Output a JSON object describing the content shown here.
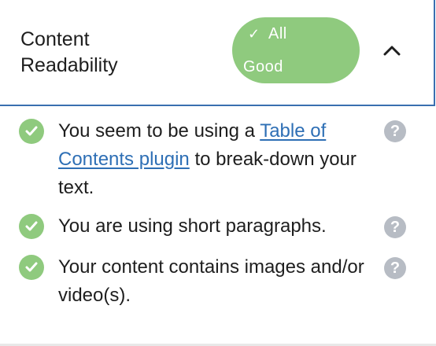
{
  "panel": {
    "title_line1": "Content",
    "title_line2": "Readability",
    "status": {
      "icon": "checkmark-icon",
      "glyph": "✓",
      "line1": "All",
      "line2": "Good",
      "color": "#8fca7e"
    },
    "toggle_icon": "chevron-up-icon"
  },
  "checks": [
    {
      "status_icon": "check-circle-icon",
      "text_before": "You seem to be using a ",
      "link_text": "Table of Contents plugin",
      "text_after": " to break-down your text.",
      "help_glyph": "?"
    },
    {
      "status_icon": "check-circle-icon",
      "text": "You are using short paragraphs.",
      "help_glyph": "?"
    },
    {
      "status_icon": "check-circle-icon",
      "text": "Your content contains images and/or video(s).",
      "help_glyph": "?"
    }
  ],
  "colors": {
    "good": "#8fca7e",
    "link": "#2e6fb5",
    "help": "#b7bcc4",
    "border_accent": "#3a6fb0"
  }
}
